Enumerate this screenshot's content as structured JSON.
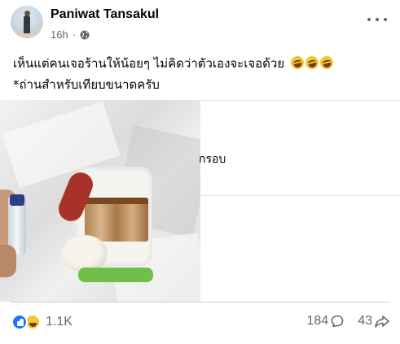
{
  "post": {
    "author": "Paniwat Tansakul",
    "time": "16h",
    "separator": "·",
    "privacy_icon": "globe-icon",
    "more_icon": "more-options-icon",
    "text_line1": "เห็นแต่คนเจอร้านให้น้อยๆ ไม่คิดว่าตัวเองจะเจอด้วย",
    "text_line1_emoji": "rofl-emoji x3",
    "text_line2": "*ถ่านสำหรับเทียบขนาดครับ",
    "photo_icon": "food-photo"
  },
  "side_panel": {
    "partial_text": "กรอบ"
  },
  "footer": {
    "reaction_icons": [
      "like-icon",
      "haha-icon"
    ],
    "reaction_count": "1.1K",
    "comment_count": "184",
    "share_count": "43"
  },
  "colors": {
    "accent": "#1877f2",
    "secondary_text": "#65676b",
    "primary_text": "#050505"
  }
}
